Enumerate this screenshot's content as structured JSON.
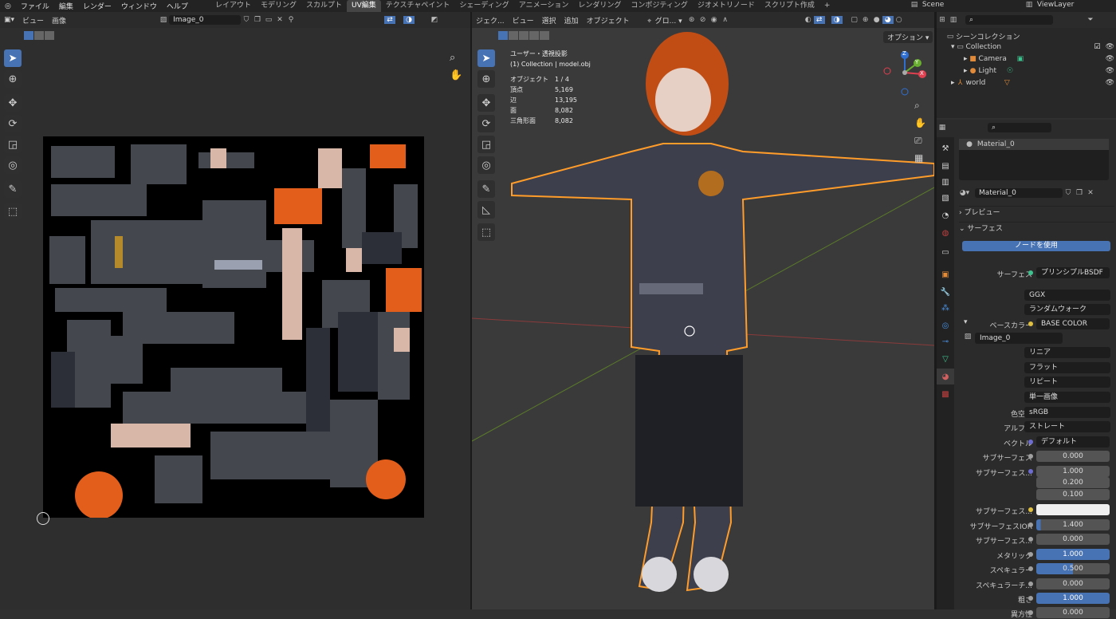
{
  "topbar": {
    "menus": [
      "ファイル",
      "編集",
      "レンダー",
      "ウィンドウ",
      "ヘルプ"
    ],
    "workspaces": [
      "レイアウト",
      "モデリング",
      "スカルプト",
      "UV編集",
      "テクスチャペイント",
      "シェーディング",
      "アニメーション",
      "レンダリング",
      "コンポジティング",
      "ジオメトリノード",
      "スクリプト作成"
    ],
    "active_workspace": "UV編集",
    "add": "+",
    "scene": "Scene",
    "view_layer": "ViewLayer"
  },
  "uv": {
    "menus": [
      "ビュー",
      "画像"
    ],
    "image_name": "Image_0"
  },
  "viewport": {
    "editor": "ジェク...",
    "menus": [
      "ビュー",
      "選択",
      "追加",
      "オブジェクト"
    ],
    "orientation": "グロ...",
    "options": "オプション",
    "projection": "ユーザー・透視投影",
    "collection_info": "(1) Collection | model.obj",
    "stats": [
      {
        "k": "オブジェクト",
        "v": "1 / 4"
      },
      {
        "k": "頂点",
        "v": "5,169"
      },
      {
        "k": "辺",
        "v": "13,195"
      },
      {
        "k": "面",
        "v": "8,082"
      },
      {
        "k": "三角形面",
        "v": "8,082"
      }
    ],
    "gizmo": {
      "x": "X",
      "y": "Y",
      "z": "Z"
    }
  },
  "outliner": {
    "title": "シーンコレクション",
    "items": [
      "Collection",
      "Camera",
      "Light",
      "world"
    ]
  },
  "props": {
    "material_slot": "Material_0",
    "material_name": "Material_0",
    "preview": "プレビュー",
    "surface_section": "サーフェス",
    "use_nodes": "ノードを使用",
    "rows": [
      {
        "label": "サーフェス",
        "value": "プリンシプルBSDF",
        "kind": "dark",
        "dot": "#3ec28f"
      },
      {
        "label": "",
        "value": "GGX",
        "kind": "menu"
      },
      {
        "label": "",
        "value": "ランダムウォーク",
        "kind": "menu"
      },
      {
        "label": "ベースカラー",
        "value": "BASE COLOR",
        "kind": "dark",
        "dot": "#e0c040"
      },
      {
        "label": "",
        "value": "Image_0",
        "kind": "img"
      },
      {
        "label": "",
        "value": "リニア",
        "kind": "menu"
      },
      {
        "label": "",
        "value": "フラット",
        "kind": "menu"
      },
      {
        "label": "",
        "value": "リピート",
        "kind": "menu"
      },
      {
        "label": "",
        "value": "単一画像",
        "kind": "menu"
      },
      {
        "label": "色空間",
        "value": "sRGB",
        "kind": "menu"
      },
      {
        "label": "アルファ",
        "value": "ストレート",
        "kind": "menu"
      },
      {
        "label": "ベクトル",
        "value": "デフォルト",
        "kind": "dark",
        "dot": "#6d6dd0"
      },
      {
        "label": "サブサーフェス",
        "value": "0.000",
        "kind": "num",
        "dot": "#a0a0a0"
      },
      {
        "label": "サブサーフェス...",
        "value": "1.000",
        "kind": "num",
        "dot": "#6d6dd0"
      },
      {
        "label": "",
        "value": "0.200",
        "kind": "num"
      },
      {
        "label": "",
        "value": "0.100",
        "kind": "num"
      },
      {
        "label": "サブサーフェス...",
        "value": "",
        "kind": "white",
        "dot": "#e0c040"
      },
      {
        "label": "サブサーフェスIOR",
        "value": "1.400",
        "kind": "num",
        "dot": "#a0a0a0"
      },
      {
        "label": "サブサーフェス...",
        "value": "0.000",
        "kind": "num",
        "dot": "#a0a0a0"
      },
      {
        "label": "メタリック",
        "value": "1.000",
        "kind": "blue",
        "dot": "#a0a0a0"
      },
      {
        "label": "スペキュラー",
        "value": "0.500",
        "kind": "half",
        "dot": "#a0a0a0"
      },
      {
        "label": "スペキュラーチ...",
        "value": "0.000",
        "kind": "num",
        "dot": "#a0a0a0"
      },
      {
        "label": "粗さ",
        "value": "1.000",
        "kind": "blue",
        "dot": "#a0a0a0"
      },
      {
        "label": "異方性",
        "value": "0.000",
        "kind": "num",
        "dot": "#a0a0a0"
      }
    ]
  }
}
